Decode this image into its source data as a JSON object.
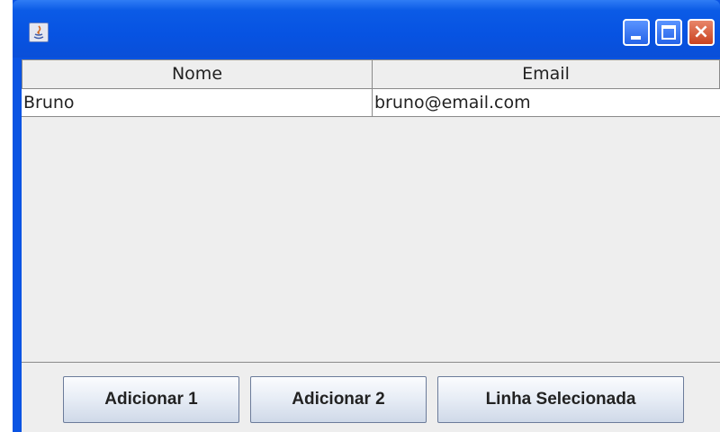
{
  "window": {
    "title": "",
    "controls": {
      "minimize": "minimize-icon",
      "maximize": "maximize-icon",
      "close": "×"
    }
  },
  "table": {
    "columns": [
      "Nome",
      "Email"
    ],
    "rows": [
      [
        "Bruno",
        "bruno@email.com"
      ]
    ]
  },
  "buttons": {
    "add1": "Adicionar 1",
    "add2": "Adicionar 2",
    "selected": "Linha Selecionada"
  }
}
